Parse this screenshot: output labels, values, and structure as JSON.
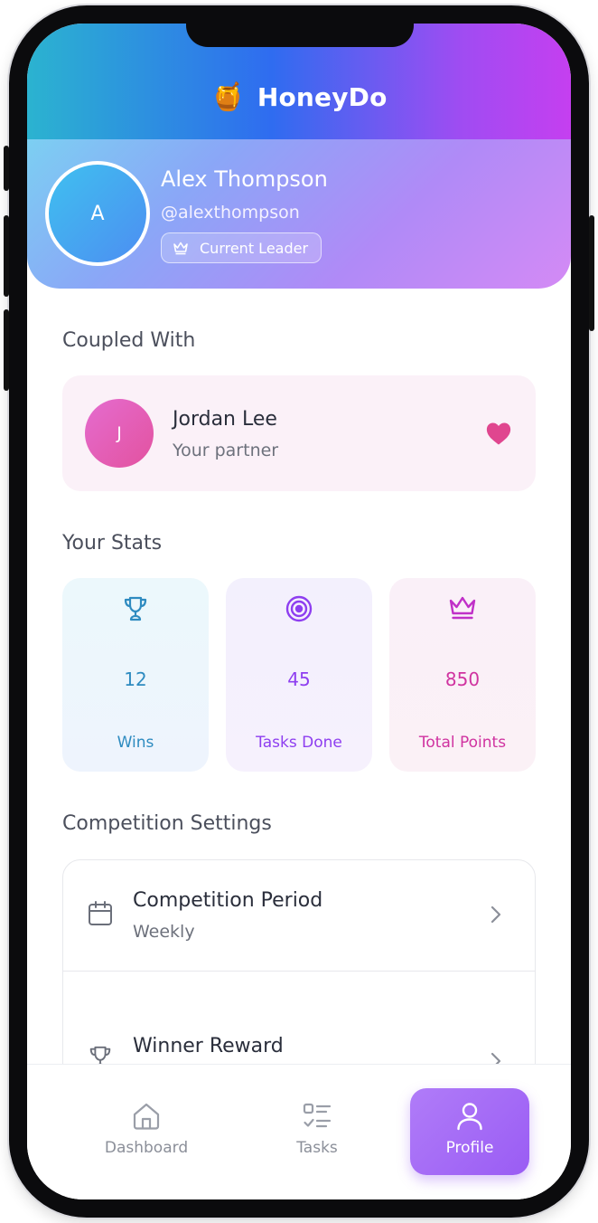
{
  "app": {
    "title": "HoneyDo",
    "logo_icon": "honey-pot-icon"
  },
  "profile": {
    "avatar_initial": "A",
    "name": "Alex Thompson",
    "handle": "@alexthompson",
    "badge": "Current Leader",
    "badge_icon": "crown-icon"
  },
  "coupled": {
    "section_title": "Coupled With",
    "partner_initial": "J",
    "partner_name": "Jordan Lee",
    "partner_role": "Your partner",
    "icon": "heart-icon"
  },
  "stats": {
    "section_title": "Your Stats",
    "items": [
      {
        "icon": "trophy-icon",
        "value": "12",
        "label": "Wins",
        "color": "#2e8bc0"
      },
      {
        "icon": "target-icon",
        "value": "45",
        "label": "Tasks Done",
        "color": "#8e3ef0"
      },
      {
        "icon": "crown-icon",
        "value": "850",
        "label": "Total Points",
        "color": "#d033a0"
      }
    ]
  },
  "settings": {
    "section_title": "Competition Settings",
    "rows": [
      {
        "icon": "calendar-icon",
        "title": "Competition Period",
        "value": "Weekly"
      },
      {
        "icon": "trophy-icon",
        "title": "Winner Reward",
        "value": ""
      }
    ]
  },
  "nav": {
    "items": [
      {
        "icon": "home-icon",
        "label": "Dashboard",
        "active": false
      },
      {
        "icon": "checklist-icon",
        "label": "Tasks",
        "active": false
      },
      {
        "icon": "user-icon",
        "label": "Profile",
        "active": true
      }
    ]
  },
  "colors": {
    "accent": "#9a5cf4",
    "heart": "#e0468f"
  }
}
